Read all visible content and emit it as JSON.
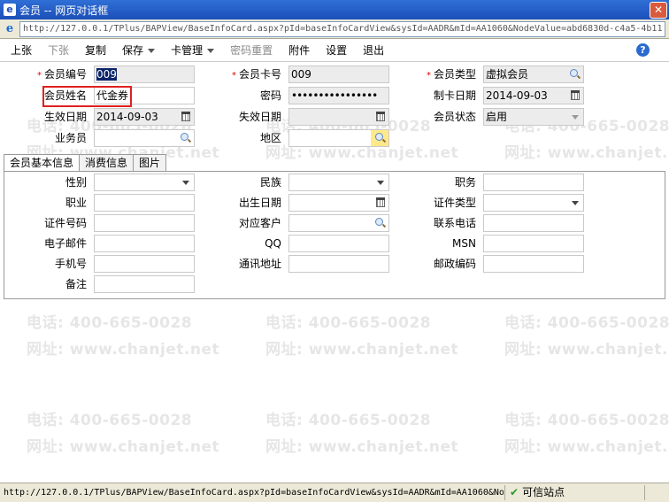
{
  "window": {
    "title": "会员 -- 网页对话框",
    "url": "http://127.0.0.1/TPlus/BAPView/BaseInfoCard.aspx?pId=baseInfoCardView&sysId=AADR&mId=AA1060&NodeValue=abd6830d-c4a5-4b11"
  },
  "toolbar": {
    "prev": "上张",
    "next": "下张",
    "copy": "复制",
    "save": "保存",
    "card_manage": "卡管理",
    "reset_password": "密码重置",
    "attachment": "附件",
    "settings": "设置",
    "exit": "退出",
    "help": "?"
  },
  "watermark": {
    "phone": "电话: 400-665-0028",
    "site": "网址: www.chanjet.net"
  },
  "form": {
    "member_no": {
      "label": "会员编号",
      "value": "009"
    },
    "card_no": {
      "label": "会员卡号",
      "value": "009"
    },
    "member_type": {
      "label": "会员类型",
      "value": "虚拟会员"
    },
    "member_name": {
      "label": "会员姓名",
      "value": "代金券"
    },
    "password": {
      "label": "密码",
      "value": "••••••••••••••••"
    },
    "card_date": {
      "label": "制卡日期",
      "value": "2014-09-03"
    },
    "effective_date": {
      "label": "生效日期",
      "value": "2014-09-03"
    },
    "expiry_date": {
      "label": "失效日期",
      "value": ""
    },
    "member_status": {
      "label": "会员状态",
      "value": "启用"
    },
    "salesman": {
      "label": "业务员",
      "value": ""
    },
    "region": {
      "label": "地区",
      "value": ""
    }
  },
  "tabs": [
    "会员基本信息",
    "消费信息",
    "图片"
  ],
  "basic_info": {
    "gender": "性别",
    "ethnicity": "民族",
    "position": "职务",
    "occupation": "职业",
    "birth_date": "出生日期",
    "id_type": "证件类型",
    "id_number": "证件号码",
    "customer": "对应客户",
    "phone": "联系电话",
    "email": "电子邮件",
    "qq": "QQ",
    "msn": "MSN",
    "mobile": "手机号",
    "address": "通讯地址",
    "postcode": "邮政编码",
    "remark": "备注"
  },
  "status": {
    "url": "http://127.0.0.1/TPlus/BAPView/BaseInfoCard.aspx?pId=baseInfoCardView&sysId=AADR&mId=AA1060&No",
    "zone": "可信站点"
  }
}
